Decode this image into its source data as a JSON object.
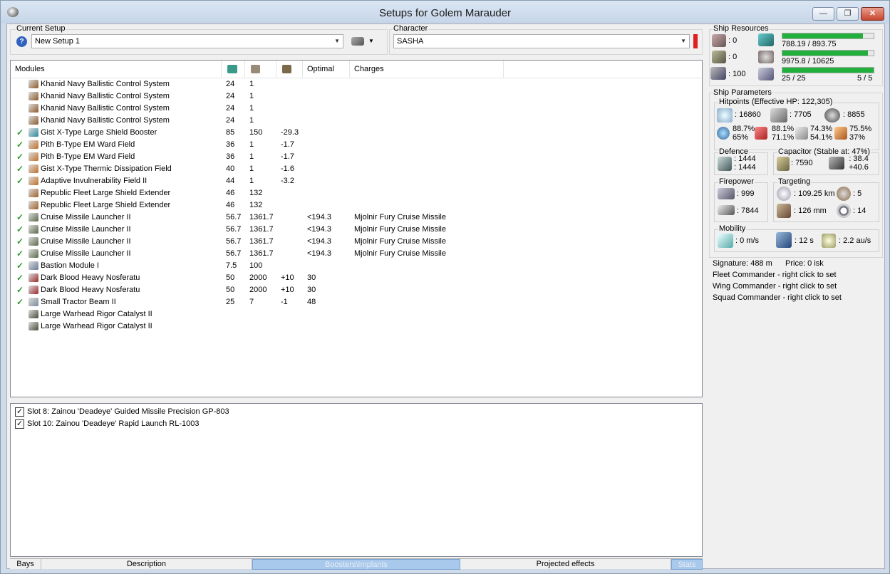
{
  "window": {
    "title": "Setups for Golem Marauder",
    "min": "▭",
    "max": "❐",
    "close": "✕"
  },
  "current_setup": {
    "label": "Current Setup",
    "value": "New Setup 1"
  },
  "character": {
    "label": "Character",
    "value": "SASHA"
  },
  "modules": {
    "headers": [
      "Modules",
      "",
      "",
      "",
      "Optimal",
      "Charges"
    ],
    "rows": [
      {
        "ok": false,
        "name": "Khanid Navy Ballistic Control System",
        "c1": "24",
        "c2": "1",
        "c3": "",
        "opt": "",
        "charge": "",
        "color": "#8b5a2b"
      },
      {
        "ok": false,
        "name": "Khanid Navy Ballistic Control System",
        "c1": "24",
        "c2": "1",
        "c3": "",
        "opt": "",
        "charge": "",
        "color": "#8b5a2b"
      },
      {
        "ok": false,
        "name": "Khanid Navy Ballistic Control System",
        "c1": "24",
        "c2": "1",
        "c3": "",
        "opt": "",
        "charge": "",
        "color": "#8b5a2b"
      },
      {
        "ok": false,
        "name": "Khanid Navy Ballistic Control System",
        "c1": "24",
        "c2": "1",
        "c3": "",
        "opt": "",
        "charge": "",
        "color": "#8b5a2b"
      },
      {
        "ok": true,
        "name": "Gist X-Type Large Shield Booster",
        "c1": "85",
        "c2": "150",
        "c3": "-29.3",
        "opt": "",
        "charge": "",
        "color": "#2a8aa0"
      },
      {
        "ok": true,
        "name": "Pith B-Type EM Ward Field",
        "c1": "36",
        "c2": "1",
        "c3": "-1.7",
        "opt": "",
        "charge": "",
        "color": "#c0702a"
      },
      {
        "ok": true,
        "name": "Pith B-Type EM Ward Field",
        "c1": "36",
        "c2": "1",
        "c3": "-1.7",
        "opt": "",
        "charge": "",
        "color": "#c0702a"
      },
      {
        "ok": true,
        "name": "Gist X-Type Thermic Dissipation Field",
        "c1": "40",
        "c2": "1",
        "c3": "-1.6",
        "opt": "",
        "charge": "",
        "color": "#c0702a"
      },
      {
        "ok": true,
        "name": "Adaptive Invulnerability Field II",
        "c1": "44",
        "c2": "1",
        "c3": "-3.2",
        "opt": "",
        "charge": "",
        "color": "#c0702a"
      },
      {
        "ok": false,
        "name": "Republic Fleet Large Shield Extender",
        "c1": "46",
        "c2": "132",
        "c3": "",
        "opt": "",
        "charge": "",
        "color": "#a0602a"
      },
      {
        "ok": false,
        "name": "Republic Fleet Large Shield Extender",
        "c1": "46",
        "c2": "132",
        "c3": "",
        "opt": "",
        "charge": "",
        "color": "#a0602a"
      },
      {
        "ok": true,
        "name": "Cruise Missile Launcher II",
        "c1": "56.7",
        "c2": "1361.7",
        "c3": "",
        "opt": "<194.3",
        "charge": "Mjolnir Fury Cruise Missile",
        "color": "#5a6a4a"
      },
      {
        "ok": true,
        "name": "Cruise Missile Launcher II",
        "c1": "56.7",
        "c2": "1361.7",
        "c3": "",
        "opt": "<194.3",
        "charge": "Mjolnir Fury Cruise Missile",
        "color": "#5a6a4a"
      },
      {
        "ok": true,
        "name": "Cruise Missile Launcher II",
        "c1": "56.7",
        "c2": "1361.7",
        "c3": "",
        "opt": "<194.3",
        "charge": "Mjolnir Fury Cruise Missile",
        "color": "#5a6a4a"
      },
      {
        "ok": true,
        "name": "Cruise Missile Launcher II",
        "c1": "56.7",
        "c2": "1361.7",
        "c3": "",
        "opt": "<194.3",
        "charge": "Mjolnir Fury Cruise Missile",
        "color": "#5a6a4a"
      },
      {
        "ok": true,
        "name": "Bastion Module I",
        "c1": "7.5",
        "c2": "100",
        "c3": "",
        "opt": "",
        "charge": "",
        "color": "#6a7a9a"
      },
      {
        "ok": true,
        "name": "Dark Blood Heavy Nosferatu",
        "c1": "50",
        "c2": "2000",
        "c3": "+10",
        "opt": "30",
        "charge": "",
        "color": "#9a2a2a"
      },
      {
        "ok": true,
        "name": "Dark Blood Heavy Nosferatu",
        "c1": "50",
        "c2": "2000",
        "c3": "+10",
        "opt": "30",
        "charge": "",
        "color": "#9a2a2a"
      },
      {
        "ok": true,
        "name": "Small Tractor Beam II",
        "c1": "25",
        "c2": "7",
        "c3": "-1",
        "opt": "48",
        "charge": "",
        "color": "#7a8a9a"
      },
      {
        "ok": false,
        "name": "Large Warhead Rigor Catalyst II",
        "c1": "",
        "c2": "",
        "c3": "",
        "opt": "",
        "charge": "",
        "color": "#4a4a3a"
      },
      {
        "ok": false,
        "name": "Large Warhead Rigor Catalyst II",
        "c1": "",
        "c2": "",
        "c3": "",
        "opt": "",
        "charge": "",
        "color": "#4a4a3a"
      }
    ]
  },
  "implants": [
    {
      "checked": true,
      "label": "Slot 8: Zainou 'Deadeye' Guided Missile Precision GP-803"
    },
    {
      "checked": true,
      "label": "Slot 10: Zainou 'Deadeye' Rapid Launch RL-1003"
    }
  ],
  "tabs": {
    "bays": "Bays",
    "description": "Description",
    "boosters": "Boosters\\Implants",
    "projected": "Projected effects",
    "stats": "Stats"
  },
  "resources": {
    "label": "Ship Resources",
    "hardpoints": [
      ": 0",
      ": 0",
      ": 100"
    ],
    "cpu": {
      "text": "788.19 / 893.75",
      "fraction": 0.882
    },
    "power": {
      "text": "9975.8 / 10625",
      "fraction": 0.939
    },
    "calibration": {
      "text": "25 / 25",
      "slots": "5 / 5",
      "fraction": 1.0
    }
  },
  "params": {
    "label": "Ship Parameters",
    "hitpoints_label": "Hitpoints (Effective HP: 122,305)",
    "hp": [
      ": 16860",
      ": 7705",
      ": 8855"
    ],
    "resists": [
      {
        "a": "88.7%",
        "b": "65%"
      },
      {
        "a": "88.1%",
        "b": "71.1%"
      },
      {
        "a": "74.3%",
        "b": "54.1%"
      },
      {
        "a": "75.5%",
        "b": "37%"
      }
    ],
    "defence": {
      "label": "Defence",
      "a": ": 1444",
      "b": ": 1444"
    },
    "capacitor": {
      "label": "Capacitor (Stable at: 47%)",
      "value": ": 7590",
      "a": ": 38.4",
      "b": "+40.6"
    },
    "firepower": {
      "label": "Firepower",
      "a": ": 999",
      "b": ": 7844"
    },
    "targeting": {
      "label": "Targeting",
      "range": ": 109.25 km",
      "targets": ": 5",
      "res": ": 126 mm",
      "scan": ": 14"
    },
    "mobility": {
      "label": "Mobility",
      "speed": ": 0 m/s",
      "align": ": 12 s",
      "warp": ": 2.2 au/s"
    },
    "signature": "Signature: 488 m",
    "price": "Price: 0 isk",
    "fleet": "Fleet Commander - right click to set",
    "wing": "Wing Commander - right click to set",
    "squad": "Squad Commander - right click to set"
  },
  "colors": {
    "bar_fill": "#22b03c",
    "accent_red": "#e02020",
    "tab_selected": "#a8c8ec"
  }
}
